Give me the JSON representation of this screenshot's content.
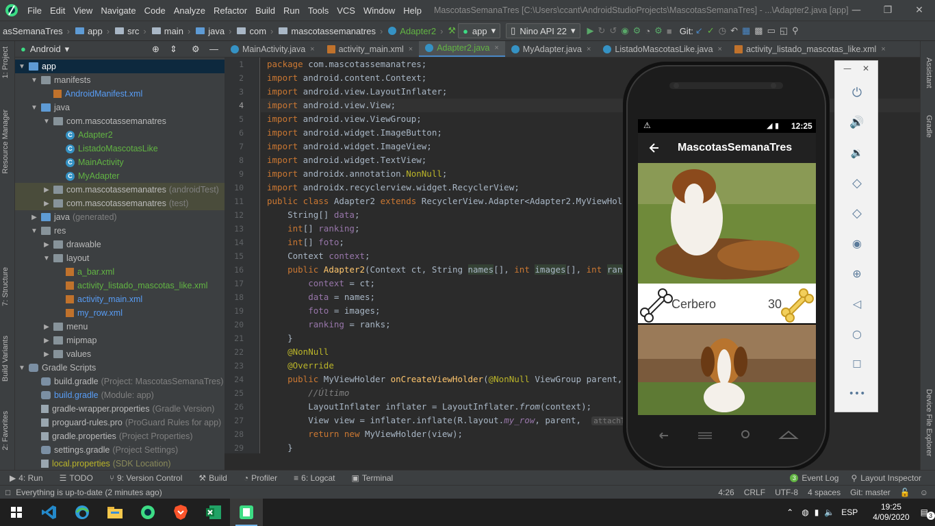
{
  "menubar": {
    "items": [
      "File",
      "Edit",
      "View",
      "Navigate",
      "Code",
      "Analyze",
      "Refactor",
      "Build",
      "Run",
      "Tools",
      "VCS",
      "Window",
      "Help"
    ],
    "window_title": "MascotasSemanaTres [C:\\Users\\ccant\\AndroidStudioProjects\\MascotasSemanaTres] - ...\\Adapter2.java [app]"
  },
  "navbar": {
    "crumbs": [
      "asSemanaTres",
      "app",
      "src",
      "main",
      "java",
      "com",
      "mascotassemanatres",
      "Adapter2"
    ],
    "config": "app",
    "device": "Nino API 22",
    "git_label": "Git:"
  },
  "left_strip": {
    "tabs": [
      "1: Project",
      "Resource Manager",
      "7: Structure",
      "Build Variants",
      "2: Favorites"
    ]
  },
  "right_strip": {
    "tabs": [
      "Assistant",
      "Gradle",
      "Device File Explorer"
    ]
  },
  "project_panel": {
    "view_label": "Android",
    "tree": [
      {
        "label": "app",
        "hint": "",
        "depth": 0,
        "arrow": "▼",
        "icon": "folder-blue",
        "style": "sel"
      },
      {
        "label": "manifests",
        "hint": "",
        "depth": 1,
        "arrow": "▼",
        "icon": "folder",
        "style": ""
      },
      {
        "label": "AndroidManifest.xml",
        "hint": "",
        "depth": 2,
        "arrow": "",
        "icon": "xml",
        "style": "link"
      },
      {
        "label": "java",
        "hint": "",
        "depth": 1,
        "arrow": "▼",
        "icon": "folder-blue",
        "style": ""
      },
      {
        "label": "com.mascotassemanatres",
        "hint": "",
        "depth": 2,
        "arrow": "▼",
        "icon": "folder",
        "style": ""
      },
      {
        "label": "Adapter2",
        "hint": "",
        "depth": 3,
        "arrow": "",
        "icon": "class",
        "style": "green"
      },
      {
        "label": "ListadoMascotasLike",
        "hint": "",
        "depth": 3,
        "arrow": "",
        "icon": "class",
        "style": "green"
      },
      {
        "label": "MainActivity",
        "hint": "",
        "depth": 3,
        "arrow": "",
        "icon": "class",
        "style": "green"
      },
      {
        "label": "MyAdapter",
        "hint": "",
        "depth": 3,
        "arrow": "",
        "icon": "class",
        "style": "green"
      },
      {
        "label": "com.mascotassemanatres",
        "hint": "(androidTest)",
        "depth": 2,
        "arrow": "▶",
        "icon": "folder",
        "style": "hl"
      },
      {
        "label": "com.mascotassemanatres",
        "hint": "(test)",
        "depth": 2,
        "arrow": "▶",
        "icon": "folder",
        "style": "hl"
      },
      {
        "label": "java",
        "hint": "(generated)",
        "depth": 1,
        "arrow": "▶",
        "icon": "folder-blue",
        "style": ""
      },
      {
        "label": "res",
        "hint": "",
        "depth": 1,
        "arrow": "▼",
        "icon": "folder",
        "style": ""
      },
      {
        "label": "drawable",
        "hint": "",
        "depth": 2,
        "arrow": "▶",
        "icon": "folder",
        "style": ""
      },
      {
        "label": "layout",
        "hint": "",
        "depth": 2,
        "arrow": "▼",
        "icon": "folder",
        "style": ""
      },
      {
        "label": "a_bar.xml",
        "hint": "",
        "depth": 3,
        "arrow": "",
        "icon": "xml",
        "style": "green"
      },
      {
        "label": "activity_listado_mascotas_like.xml",
        "hint": "",
        "depth": 3,
        "arrow": "",
        "icon": "xml",
        "style": "green"
      },
      {
        "label": "activity_main.xml",
        "hint": "",
        "depth": 3,
        "arrow": "",
        "icon": "xml",
        "style": "link"
      },
      {
        "label": "my_row.xml",
        "hint": "",
        "depth": 3,
        "arrow": "",
        "icon": "xml",
        "style": "link"
      },
      {
        "label": "menu",
        "hint": "",
        "depth": 2,
        "arrow": "▶",
        "icon": "folder",
        "style": ""
      },
      {
        "label": "mipmap",
        "hint": "",
        "depth": 2,
        "arrow": "▶",
        "icon": "folder",
        "style": ""
      },
      {
        "label": "values",
        "hint": "",
        "depth": 2,
        "arrow": "▶",
        "icon": "folder",
        "style": ""
      },
      {
        "label": "Gradle Scripts",
        "hint": "",
        "depth": 0,
        "arrow": "▼",
        "icon": "gradle",
        "style": ""
      },
      {
        "label": "build.gradle",
        "hint": "(Project: MascotasSemanaTres)",
        "depth": 1,
        "arrow": "",
        "icon": "gradle",
        "style": ""
      },
      {
        "label": "build.gradle",
        "hint": "(Module: app)",
        "depth": 1,
        "arrow": "",
        "icon": "gradle",
        "style": "link"
      },
      {
        "label": "gradle-wrapper.properties",
        "hint": "(Gradle Version)",
        "depth": 1,
        "arrow": "",
        "icon": "file",
        "style": ""
      },
      {
        "label": "proguard-rules.pro",
        "hint": "(ProGuard Rules for app)",
        "depth": 1,
        "arrow": "",
        "icon": "file",
        "style": ""
      },
      {
        "label": "gradle.properties",
        "hint": "(Project Properties)",
        "depth": 1,
        "arrow": "",
        "icon": "file",
        "style": ""
      },
      {
        "label": "settings.gradle",
        "hint": "(Project Settings)",
        "depth": 1,
        "arrow": "",
        "icon": "gradle",
        "style": ""
      },
      {
        "label": "local.properties",
        "hint": "(SDK Location)",
        "depth": 1,
        "arrow": "",
        "icon": "file",
        "style": "yellow"
      }
    ]
  },
  "editor_tabs": [
    {
      "label": "MainActivity.java",
      "kind": "class",
      "active": false
    },
    {
      "label": "activity_main.xml",
      "kind": "xml",
      "active": false
    },
    {
      "label": "Adapter2.java",
      "kind": "class",
      "active": true
    },
    {
      "label": "MyAdapter.java",
      "kind": "class",
      "active": false
    },
    {
      "label": "ListadoMascotasLike.java",
      "kind": "class",
      "active": false
    },
    {
      "label": "activity_listado_mascotas_like.xml",
      "kind": "xml",
      "active": false
    }
  ],
  "editor": {
    "current_line": 4,
    "line_numbers": [
      "1",
      "2",
      "3",
      "4",
      "5",
      "6",
      "7",
      "8",
      "9",
      "10",
      "11",
      "12",
      "13",
      "14",
      "15",
      "16",
      "17",
      "18",
      "19",
      "20",
      "21",
      "22",
      "23",
      "24",
      "25",
      "26",
      "27",
      "28",
      "29"
    ]
  },
  "emulator": {
    "status_time": "12:25",
    "app_title": "MascotasSemanaTres",
    "card1_name": "Cerbero",
    "card1_rank": "30"
  },
  "bottom_tabs": [
    "4: Run",
    "TODO",
    "9: Version Control",
    "Build",
    "Profiler",
    "6: Logcat",
    "Terminal"
  ],
  "bottom_right_tabs": [
    "Event Log",
    "Layout Inspector"
  ],
  "event_log_count": "3",
  "status": {
    "message": "Everything is up-to-date (2 minutes ago)",
    "position": "4:26",
    "line_sep": "CRLF",
    "encoding": "UTF-8",
    "indent": "4 spaces",
    "branch": "Git: master"
  },
  "taskbar": {
    "lang": "ESP",
    "time": "19:25",
    "date": "4/09/2020",
    "notif_count": "3"
  },
  "colors": {
    "ide_bg": "#2b2b2b",
    "panel_bg": "#3c3f41",
    "keyword": "#cc7832",
    "annotation": "#bbb529",
    "accent": "#4a88c7",
    "app_bar": "#212121"
  }
}
